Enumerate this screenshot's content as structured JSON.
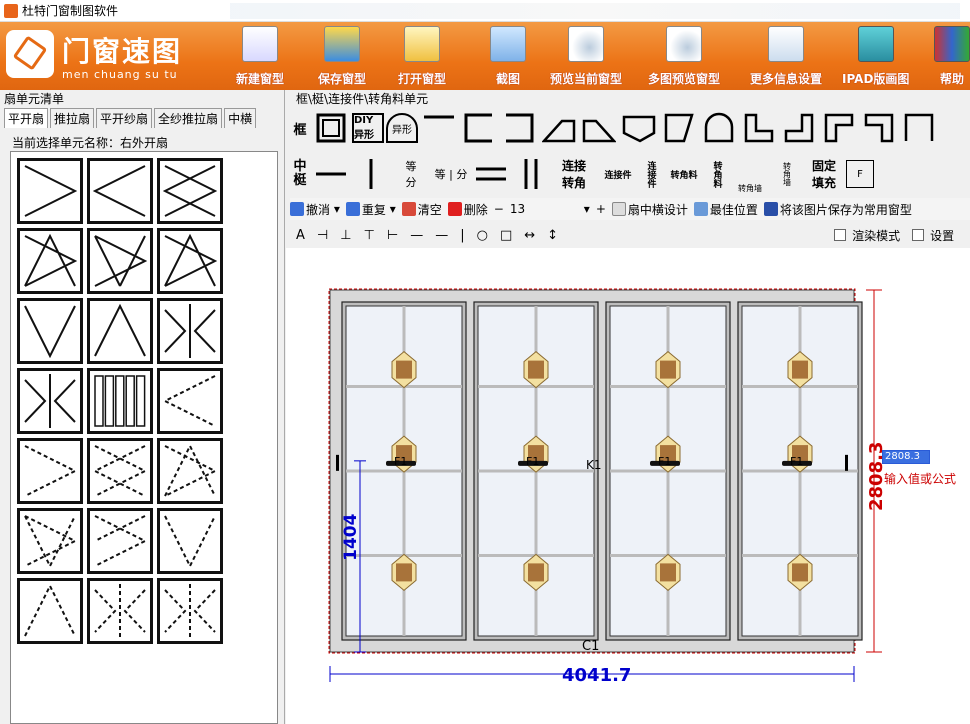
{
  "window": {
    "title": "杜特门窗制图软件"
  },
  "logo": {
    "name": "门窗速图",
    "pinyin": "men chuang su tu"
  },
  "ribbon": {
    "buttons": [
      {
        "label": "新建窗型",
        "icon": "new-file-icon"
      },
      {
        "label": "保存窗型",
        "icon": "save-icon"
      },
      {
        "label": "打开窗型",
        "icon": "open-folder-icon"
      },
      {
        "label": "截图",
        "icon": "screenshot-icon"
      },
      {
        "label": "预览当前窗型",
        "icon": "preview-icon"
      },
      {
        "label": "多图预览窗型",
        "icon": "multi-preview-icon"
      },
      {
        "label": "更多信息设置",
        "icon": "settings-check-icon"
      },
      {
        "label": "IPAD版画图",
        "icon": "ipad-icon"
      },
      {
        "label": "帮助",
        "icon": "help-books-icon"
      }
    ]
  },
  "left_panel": {
    "header": "扇单元清单",
    "tabs": [
      "平开扇",
      "推拉扇",
      "平开纱扇",
      "全纱推拉扇",
      "中横"
    ],
    "active_tab": "平开扇",
    "selected_label": "当前选择单元名称：右外开扇"
  },
  "palette": {
    "title": "框\\梃\\连接件\\转角料单元",
    "row1_label": "框",
    "row2_label_top": "中",
    "row2_label_bottom": "梃",
    "items_row2": {
      "equal_top": "等",
      "equal_bottom": "分",
      "equal_side": "等",
      "equal_side2": "分",
      "connect_turn_top": "连接",
      "connect_turn_bottom": "转角",
      "connector": "连接件",
      "connector_v": "连接件",
      "corner_material": "转角料",
      "corner_material_v": "转角料",
      "corner_panel": "转角墙",
      "corner_panel_v": "转角墙",
      "fixed_fill_top": "固定",
      "fixed_fill_bottom": "填充",
      "f_label": "F"
    },
    "diy_label": "DIY异形",
    "arch_label": "异形"
  },
  "toolbar": {
    "undo": "撤消",
    "redo": "重复",
    "clear": "清空",
    "delete": "删除",
    "minus": "−",
    "value": "13",
    "plus": "+",
    "sash_mullion": "扇中横设计",
    "best_position": "最佳位置",
    "save_common": "将该图片保存为常用窗型"
  },
  "toolbar2": {
    "text_tool": "A",
    "render_mode": "渲染模式",
    "settings": "设置"
  },
  "canvas": {
    "width_dim": "4041.7",
    "height_dim": "2808.3",
    "sash_height_dim": "1404",
    "input_value": "2808.3",
    "input_hint": "输入值或公式",
    "label_bottom": "C1",
    "label_mid": "K1",
    "sash_labels": [
      "F1",
      "F1",
      "F1",
      "F1"
    ],
    "accent_dim_red": "#cc0000",
    "accent_dim_blue": "#0000cc"
  }
}
